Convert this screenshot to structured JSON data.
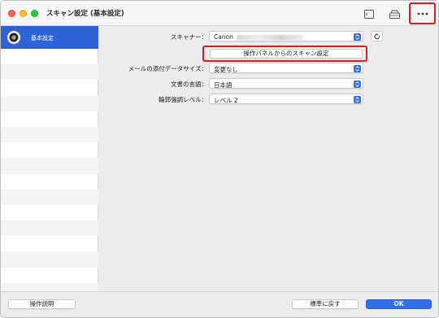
{
  "window": {
    "title": "スキャン設定 (基本設定)"
  },
  "toolbar": {
    "icons": [
      "document-icon",
      "scanner-icon",
      "more-icon"
    ]
  },
  "sidebar": {
    "items": [
      {
        "label": "基本設定",
        "icon": "settings-icon",
        "selected": true
      }
    ]
  },
  "settings": {
    "scanner": {
      "label": "スキャナー：",
      "value": "Canon"
    },
    "scan_from_panel_button": "操作パネルからのスキャン設定",
    "attachment_size": {
      "label": "メールの添付データサイズ：",
      "value": "変更なし"
    },
    "document_language": {
      "label": "文書の言語：",
      "value": "日本語"
    },
    "edge_enhancement": {
      "label": "輪郭強調レベル：",
      "value": "レベル 2"
    }
  },
  "footer": {
    "help_button": "操作説明",
    "defaults_button": "標準に戻す",
    "ok_button": "OK"
  },
  "colors": {
    "accent": "#2f6fe4",
    "selection": "#2d62d8",
    "highlight": "#e5191d"
  }
}
